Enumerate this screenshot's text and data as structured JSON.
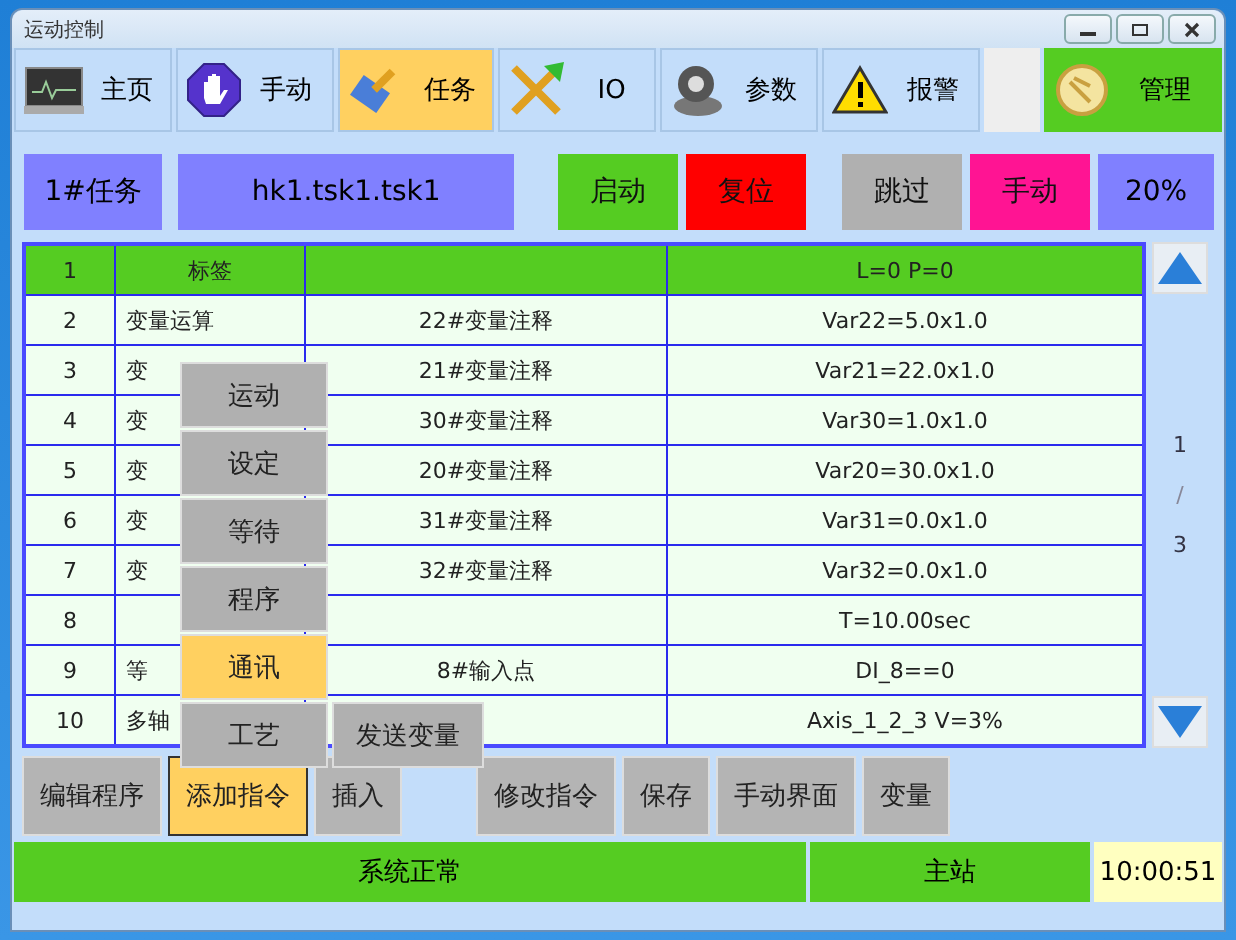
{
  "window": {
    "title": "运动控制"
  },
  "toolbar": [
    {
      "label": "主页",
      "kind": "tab",
      "selected": false
    },
    {
      "label": "手动",
      "kind": "tab",
      "selected": false
    },
    {
      "label": "任务",
      "kind": "tab",
      "selected": true
    },
    {
      "label": "IO",
      "kind": "tab",
      "selected": false
    },
    {
      "label": "参数",
      "kind": "tab",
      "selected": false
    },
    {
      "label": "报警",
      "kind": "tab",
      "selected": false
    },
    {
      "label": "管理",
      "kind": "admin"
    }
  ],
  "task_bar": {
    "task": "1#任务",
    "program": "hk1.tsk1.tsk1",
    "buttons": [
      {
        "label": "启动",
        "color": "#55cc22"
      },
      {
        "label": "复位",
        "color": "#ff0000"
      }
    ],
    "mode_buttons": [
      {
        "label": "跳过",
        "color": "#b0b0b0"
      },
      {
        "label": "手动",
        "color": "#ff1493"
      }
    ],
    "speed": "20%"
  },
  "table": {
    "rows": [
      {
        "no": "1",
        "label": "标签",
        "value": "L=0 P=0",
        "selected": true
      },
      {
        "no": "2",
        "label": "变量运算",
        "comment": "22#变量注释",
        "value": "Var22=5.0x1.0",
        "selected": false
      },
      {
        "no": "3",
        "label": "变",
        "comment": "21#变量注释",
        "value": "Var21=22.0x1.0",
        "selected": false
      },
      {
        "no": "4",
        "label": "变",
        "comment": "30#变量注释",
        "value": "Var30=1.0x1.0",
        "selected": false
      },
      {
        "no": "5",
        "label": "变",
        "comment": "20#变量注释",
        "value": "Var20=30.0x1.0",
        "selected": false
      },
      {
        "no": "6",
        "label": "变",
        "comment": "31#变量注释",
        "value": "Var31=0.0x1.0",
        "selected": false
      },
      {
        "no": "7",
        "label": "变",
        "comment": "32#变量注释",
        "value": "Var32=0.0x1.0",
        "selected": false
      },
      {
        "no": "8",
        "value": "T=10.00sec",
        "selected": false
      },
      {
        "no": "9",
        "label": "等",
        "comment": "8#输入点",
        "value": "DI_8==0",
        "selected": false
      },
      {
        "no": "10",
        "label": "多轴",
        "value": "Axis_1_2_3 V=3%",
        "selected": false
      }
    ]
  },
  "pager": {
    "page": "1",
    "separator": "/",
    "total": "3"
  },
  "menu": {
    "items": [
      {
        "label": "运动",
        "selected": false
      },
      {
        "label": "设定",
        "selected": false
      },
      {
        "label": "等待",
        "selected": false
      },
      {
        "label": "程序",
        "selected": false
      },
      {
        "label": "通讯",
        "selected": true
      },
      {
        "label": "工艺",
        "selected": false
      }
    ],
    "submenu": [
      "发送变量"
    ]
  },
  "bottom_buttons": [
    {
      "label": "编辑程序",
      "selected": false
    },
    {
      "label": "添加指令",
      "selected": true
    },
    {
      "label": "插入",
      "selected": false
    },
    {
      "label": "修改指令",
      "selected": false
    },
    {
      "label": "保存",
      "selected": false
    },
    {
      "label": "手动界面",
      "selected": false
    },
    {
      "label": "变量",
      "selected": false
    }
  ],
  "status_bar": {
    "message": "系统正常",
    "station": "主站",
    "time": "10:00:51"
  }
}
